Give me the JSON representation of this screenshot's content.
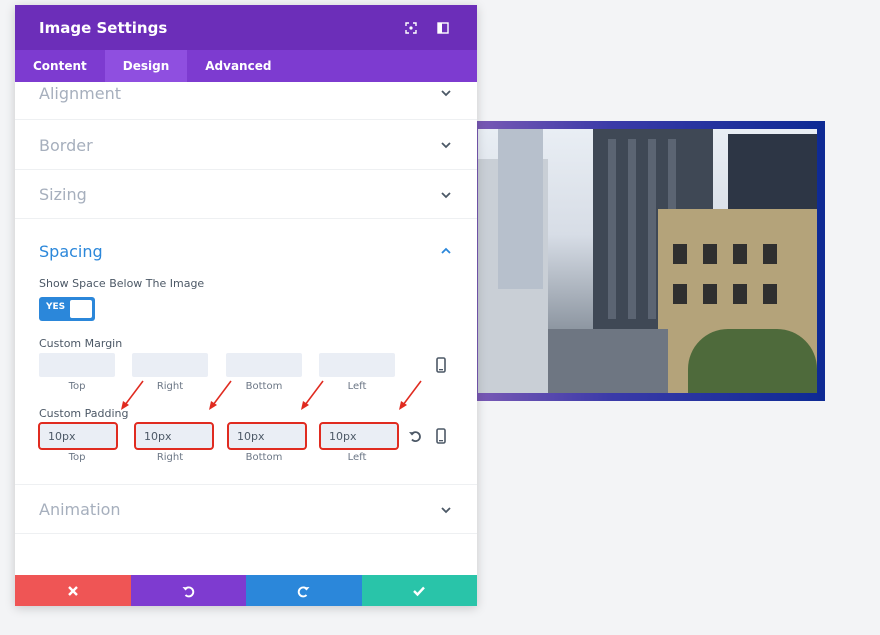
{
  "header": {
    "title": "Image Settings"
  },
  "tabs": [
    {
      "label": "Content",
      "active": false
    },
    {
      "label": "Design",
      "active": true
    },
    {
      "label": "Advanced",
      "active": false
    }
  ],
  "sections": {
    "alignment": "Alignment",
    "border": "Border",
    "sizing": "Sizing",
    "spacing": "Spacing",
    "animation": "Animation"
  },
  "spacing": {
    "show_space_label": "Show Space Below The Image",
    "toggle_label": "YES",
    "margin_label": "Custom Margin",
    "padding_label": "Custom Padding",
    "sides": [
      "Top",
      "Right",
      "Bottom",
      "Left"
    ],
    "margin_values": [
      "",
      "",
      "",
      ""
    ],
    "padding_values": [
      "10px",
      "10px",
      "10px",
      "10px"
    ]
  },
  "colors": {
    "header": "#6c2eb9",
    "tabs": "#7d3bd0",
    "accent": "#2b87da",
    "highlight": "#e02b20",
    "discard": "#ef5555",
    "undo": "#7e3bd0",
    "redo": "#2b87da",
    "save": "#29c4a9"
  },
  "icons": {
    "header": [
      "focus-icon",
      "split-view-icon"
    ],
    "footer": [
      "close-icon",
      "undo-icon",
      "redo-icon",
      "check-icon"
    ]
  }
}
